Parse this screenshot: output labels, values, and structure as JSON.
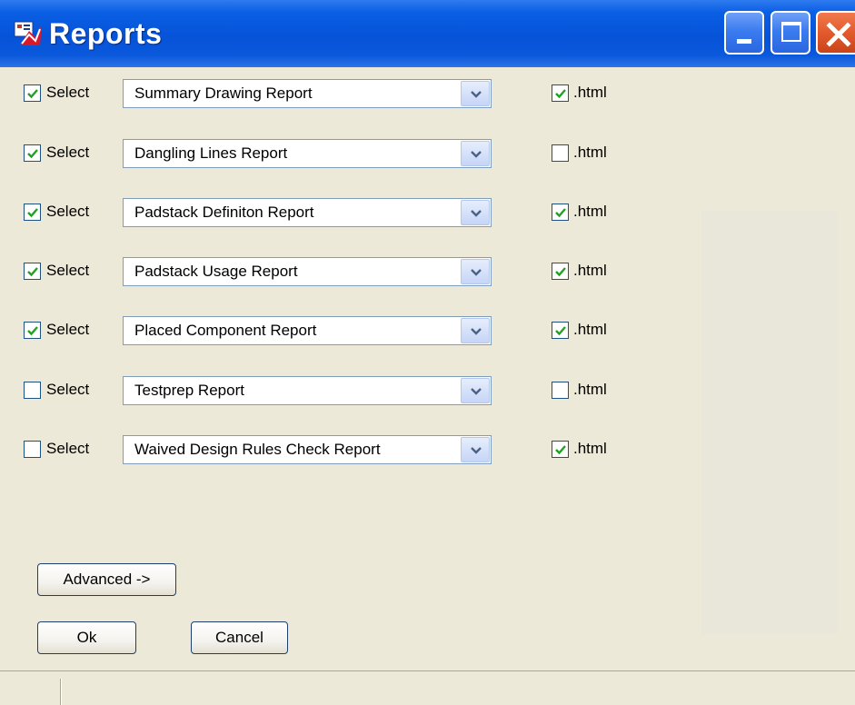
{
  "window": {
    "title": "Reports",
    "icon": "app-report-icon",
    "controls": {
      "minimize": "minimize-icon",
      "maximize": "maximize-icon",
      "close": "close-icon"
    }
  },
  "rows": [
    {
      "select_checked": true,
      "select_label": "Select",
      "report": "Summary Drawing Report",
      "html_checked": true,
      "html_label": ".html"
    },
    {
      "select_checked": true,
      "select_label": "Select",
      "report": "Dangling Lines Report",
      "html_checked": false,
      "html_label": ".html"
    },
    {
      "select_checked": true,
      "select_label": "Select",
      "report": "Padstack Definiton Report",
      "html_checked": true,
      "html_label": ".html"
    },
    {
      "select_checked": true,
      "select_label": "Select",
      "report": "Padstack Usage Report",
      "html_checked": true,
      "html_label": ".html"
    },
    {
      "select_checked": true,
      "select_label": "Select",
      "report": "Placed Component Report",
      "html_checked": true,
      "html_label": ".html"
    },
    {
      "select_checked": false,
      "select_label": "Select",
      "report": "Testprep Report",
      "html_checked": false,
      "html_label": ".html"
    },
    {
      "select_checked": false,
      "select_label": "Select",
      "report": "Waived Design Rules Check Report",
      "html_checked": true,
      "html_label": ".html"
    }
  ],
  "buttons": {
    "advanced": "Advanced ->",
    "ok": "Ok",
    "cancel": "Cancel"
  },
  "colors": {
    "titlebar": "#0653d8",
    "checkmark": "#21a121",
    "close_button": "#e35a2c"
  }
}
